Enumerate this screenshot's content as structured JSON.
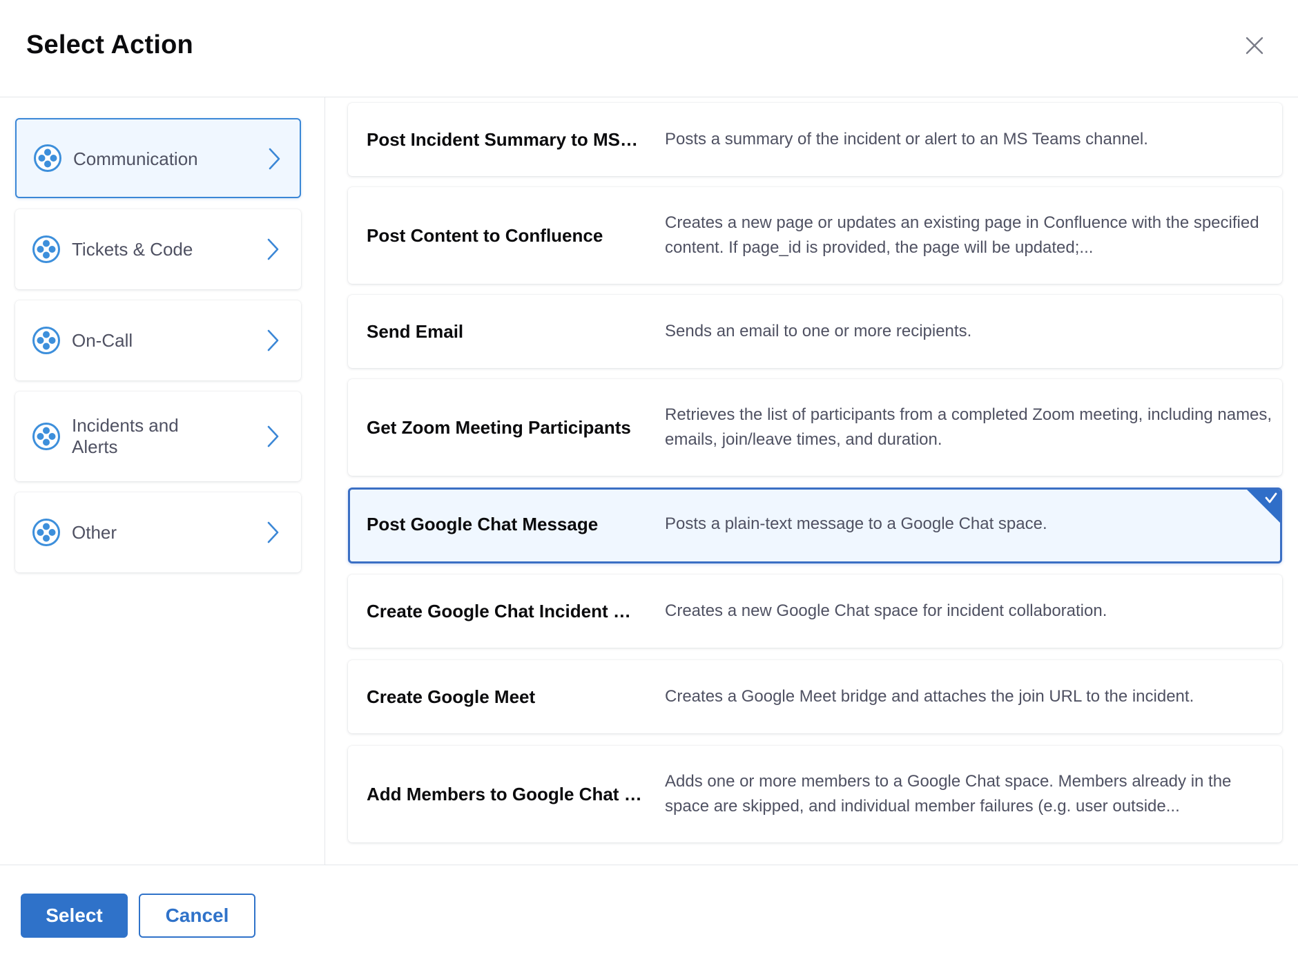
{
  "dialog": {
    "title": "Select Action",
    "close_icon": "close-icon"
  },
  "colors": {
    "accent": "#2f72c9",
    "selected_bg": "#f0f7ff",
    "text_primary": "#0b0b0d",
    "text_secondary": "#4f5162"
  },
  "sidebar": {
    "items": [
      {
        "label": "Communication",
        "icon": "integration-icon",
        "active": true
      },
      {
        "label": "Tickets & Code",
        "icon": "integration-icon",
        "active": false
      },
      {
        "label": "On-Call",
        "icon": "integration-icon",
        "active": false
      },
      {
        "label": "Incidents and Alerts",
        "icon": "integration-icon",
        "active": false
      },
      {
        "label": "Other",
        "icon": "integration-icon",
        "active": false
      }
    ]
  },
  "actions": [
    {
      "name": "Post Incident Summary to MS Teams",
      "description": "Posts a summary of the incident or alert to an MS Teams channel.",
      "selected": false
    },
    {
      "name": "Post Content to Confluence",
      "description": "Creates a new page or updates an existing page in Confluence with the specified content. If page_id is provided, the page will be updated;...",
      "selected": false
    },
    {
      "name": "Send Email",
      "description": "Sends an email to one or more recipients.",
      "selected": false
    },
    {
      "name": "Get Zoom Meeting Participants",
      "description": "Retrieves the list of participants from a completed Zoom meeting, including names, emails, join/leave times, and duration.",
      "selected": false
    },
    {
      "name": "Post Google Chat Message",
      "description": "Posts a plain-text message to a Google Chat space.",
      "selected": true
    },
    {
      "name": "Create Google Chat Incident Space",
      "description": "Creates a new Google Chat space for incident collaboration.",
      "selected": false
    },
    {
      "name": "Create Google Meet",
      "description": "Creates a Google Meet bridge and attaches the join URL to the incident.",
      "selected": false
    },
    {
      "name": "Add Members to Google Chat Space",
      "description": "Adds one or more members to a Google Chat space. Members already in the space are skipped, and individual member failures (e.g. user outside...",
      "selected": false
    }
  ],
  "footer": {
    "select_label": "Select",
    "cancel_label": "Cancel"
  }
}
